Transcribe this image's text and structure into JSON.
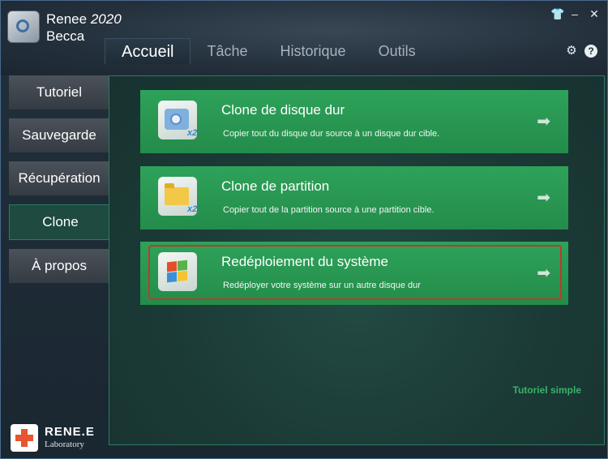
{
  "app": {
    "name": "Renee",
    "year": "2020",
    "subtitle": "Becca"
  },
  "window_controls": {
    "skin": "👕",
    "minimize": "–",
    "close": "✕"
  },
  "tabs": [
    {
      "label": "Accueil",
      "active": true
    },
    {
      "label": "Tâche"
    },
    {
      "label": "Historique"
    },
    {
      "label": "Outils"
    }
  ],
  "top_icons": {
    "settings": "⚙",
    "help": "?"
  },
  "sidebar": {
    "items": [
      {
        "label": "Tutoriel"
      },
      {
        "label": "Sauvegarde"
      },
      {
        "label": "Récupération"
      },
      {
        "label": "Clone",
        "active": true
      },
      {
        "label": "À propos"
      }
    ]
  },
  "cards": [
    {
      "title": "Clone de disque dur",
      "desc": "Copier tout du disque dur source à un disque dur cible.",
      "badge": "x2",
      "icon": "hard-disk-icon"
    },
    {
      "title": "Clone de partition",
      "desc": "Copier tout de la partition source à une partition cible.",
      "badge": "x2",
      "icon": "folder-icon"
    },
    {
      "title": "Redéploiement du système",
      "desc": "Redéployer votre système sur un autre disque dur",
      "icon": "windows-logo-icon",
      "selected": true
    }
  ],
  "arrow": "➡",
  "simple_tutorial": "Tutoriel simple",
  "brand": {
    "name": "RENE.E",
    "sub": "Laboratory"
  },
  "colors": {
    "accent_green": "#2ea25a",
    "highlight_red": "#c0392b",
    "link_green": "#39b36a"
  }
}
